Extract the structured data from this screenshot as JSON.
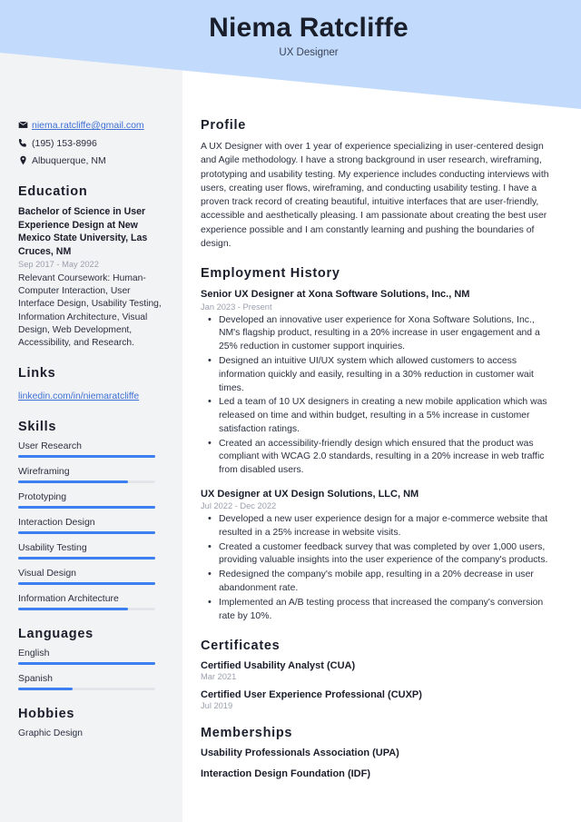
{
  "header": {
    "name": "Niema Ratcliffe",
    "title": "UX Designer",
    "banner_color": "#c2dbfc"
  },
  "sidebar": {
    "contact": {
      "email": "niema.ratcliffe@gmail.com",
      "phone": "(195) 153-8996",
      "location": "Albuquerque, NM",
      "email_icon": "envelope-icon",
      "phone_icon": "phone-icon",
      "location_icon": "map-pin-icon"
    },
    "education": {
      "heading": "Education",
      "degree": "Bachelor of Science in User Experience Design at New Mexico State University, Las Cruces, NM",
      "date": "Sep 2017 - May 2022",
      "coursework": "Relevant Coursework: Human-Computer Interaction, User Interface Design, Usability Testing, Information Architecture, Visual Design, Web Development, Accessibility, and Research."
    },
    "links": {
      "heading": "Links",
      "items": [
        {
          "label": "linkedin.com/in/niemaratcliffe"
        }
      ]
    },
    "skills": {
      "heading": "Skills",
      "items": [
        {
          "label": "User Research",
          "level": 100
        },
        {
          "label": "Wireframing",
          "level": 80
        },
        {
          "label": "Prototyping",
          "level": 100
        },
        {
          "label": "Interaction Design",
          "level": 100
        },
        {
          "label": "Usability Testing",
          "level": 100
        },
        {
          "label": "Visual Design",
          "level": 100
        },
        {
          "label": "Information Architecture",
          "level": 80
        }
      ]
    },
    "languages": {
      "heading": "Languages",
      "items": [
        {
          "label": "English",
          "level": 100
        },
        {
          "label": "Spanish",
          "level": 40
        }
      ]
    },
    "hobbies": {
      "heading": "Hobbies",
      "items": [
        {
          "label": "Graphic Design"
        }
      ]
    },
    "accent_color": "#3b7ff0"
  },
  "main": {
    "profile": {
      "heading": "Profile",
      "text": "A UX Designer with over 1 year of experience specializing in user-centered design and Agile methodology. I have a strong background in user research, wireframing, prototyping and usability testing. My experience includes conducting interviews with users, creating user flows, wireframing, and conducting usability testing. I have a proven track record of creating beautiful, intuitive interfaces that are user-friendly, accessible and aesthetically pleasing. I am passionate about creating the best user experience possible and I am constantly learning and pushing the boundaries of design."
    },
    "employment": {
      "heading": "Employment History",
      "jobs": [
        {
          "title": "Senior UX Designer at Xona Software Solutions, Inc., NM",
          "date": "Jan 2023 - Present",
          "bullets": [
            "Developed an innovative user experience for Xona Software Solutions, Inc., NM's flagship product, resulting in a 20% increase in user engagement and a 25% reduction in customer support inquiries.",
            "Designed an intuitive UI/UX system which allowed customers to access information quickly and easily, resulting in a 30% reduction in customer wait times.",
            "Led a team of 10 UX designers in creating a new mobile application which was released on time and within budget, resulting in a 5% increase in customer satisfaction ratings.",
            "Created an accessibility-friendly design which ensured that the product was compliant with WCAG 2.0 standards, resulting in a 20% increase in web traffic from disabled users."
          ]
        },
        {
          "title": "UX Designer at UX Design Solutions, LLC, NM",
          "date": "Jul 2022 - Dec 2022",
          "bullets": [
            "Developed a new user experience design for a major e-commerce website that resulted in a 25% increase in website visits.",
            "Created a customer feedback survey that was completed by over 1,000 users, providing valuable insights into the user experience of the company's products.",
            "Redesigned the company's mobile app, resulting in a 20% decrease in user abandonment rate.",
            "Implemented an A/B testing process that increased the company's conversion rate by 10%."
          ]
        }
      ]
    },
    "certificates": {
      "heading": "Certificates",
      "items": [
        {
          "name": "Certified Usability Analyst (CUA)",
          "date": "Mar 2021"
        },
        {
          "name": "Certified User Experience Professional (CUXP)",
          "date": "Jul 2019"
        }
      ]
    },
    "memberships": {
      "heading": "Memberships",
      "items": [
        {
          "name": "Usability Professionals Association (UPA)"
        },
        {
          "name": "Interaction Design Foundation (IDF)"
        }
      ]
    }
  }
}
